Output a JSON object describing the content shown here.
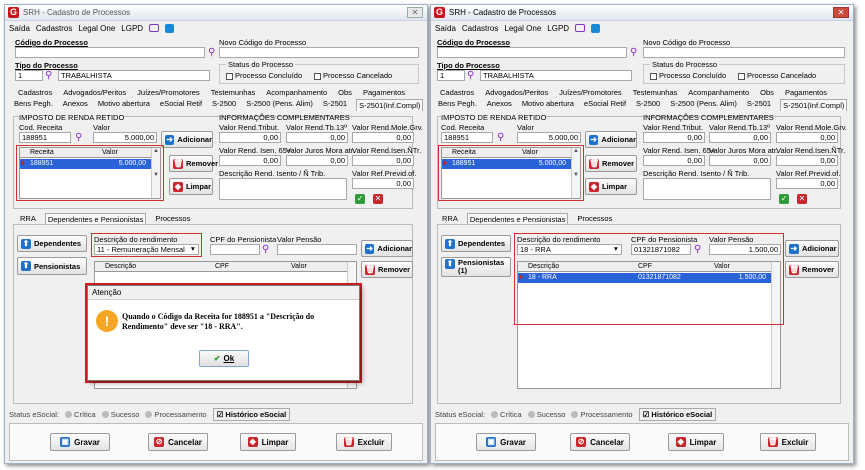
{
  "window": {
    "logo": "G",
    "title": "SRH - Cadastro de Processos",
    "close": "✕"
  },
  "menu": [
    "Saída",
    "Cadastros",
    "Legal One",
    "LGPD"
  ],
  "fields": {
    "codigo_processo": "Código do Processo",
    "novo_codigo": "Novo Código do Processo",
    "tipo_processo": "Tipo do Processo",
    "tipo_code": "1",
    "tipo_value": "TRABALHISTA",
    "status_group": "Status do Processo",
    "concluido": "Processo Concluído",
    "cancelado": "Processo Cancelado"
  },
  "tabs_row1": [
    "Cadastros",
    "Advogados/Peritos",
    "Juízes/Promotores",
    "Testemunhas",
    "Acompanhamento",
    "Obs",
    "Pagamentos"
  ],
  "tabs_row2": [
    "Bens Pegh.",
    "Anexos",
    "Motivo abertura",
    "eSocial Retif",
    "S-2500",
    "S-2500 (Pens. Alim)",
    "S-2501",
    "S-2501(Inf.Compl)"
  ],
  "irr": {
    "title": "IMPOSTO DE RENDA RETIDO",
    "cod_label": "Cod. Receita",
    "cod_value": "188951",
    "valor_label": "Valor",
    "valor_value": "5.000,00",
    "grid_headers": [
      "Receita",
      "Valor"
    ],
    "grid_row": [
      "188951",
      "5.000,00"
    ],
    "btn_add": "Adicionar",
    "btn_remove": "Remover",
    "btn_clear": "Limpar"
  },
  "info": {
    "title": "INFORMAÇÕES COMPLEMENTARES",
    "labels": [
      "Valor Rend.Tribut.",
      "Valor Rend.Tb.13º",
      "Valor Rend.Mole.Grv."
    ],
    "values": [
      "0,00",
      "0,00",
      "0,00"
    ],
    "labels2": [
      "Valor Rend. Isen. 65+",
      "Valor Juros Mora atr.",
      "Valor Rend.Isen.ÑTr."
    ],
    "values2": [
      "0,00",
      "0,00",
      "0,00"
    ],
    "desc_label": "Descrição Rend. Isento / Ñ Trib.",
    "prev_label": "Valor Ref.Previd.of.",
    "prev_value": "0,00"
  },
  "subtabs": [
    "RRA",
    "Dependentes e Pensionistas",
    "Processos"
  ],
  "dep": {
    "btn_dependentes": "Dependentes",
    "btn_pensionistas": "Pensionistas",
    "btn_pensionistas_count": "(1)",
    "desc_label": "Descrição do rendimento",
    "desc_left": "11 - Remuneração Mensal",
    "desc_right": "18 - RRA",
    "cpf_label": "CPF do Pensionista",
    "cpf_right": "01321871082",
    "valor_label": "Valor Pensão",
    "valor_right": "1.500,00",
    "btn_add": "Adicionar",
    "btn_remove": "Remover",
    "grid_headers": [
      "Descrição",
      "CPF",
      "Valor"
    ],
    "grid_row": [
      "18 - RRA",
      "01321871082",
      "1.500,00"
    ]
  },
  "status": {
    "label": "Status eSocial:",
    "items": [
      "Crítica",
      "Sucesso",
      "Processamento"
    ],
    "hist": "Histórico eSocial"
  },
  "buttons": [
    "Gravar",
    "Cancelar",
    "Limpar",
    "Excluir"
  ],
  "dialog": {
    "title": "Atenção",
    "message": "Quando o Código da Receita for 188951 a \"Descrição do Rendimento\" deve ser \"18 - RRA\".",
    "ok": "Ok"
  }
}
